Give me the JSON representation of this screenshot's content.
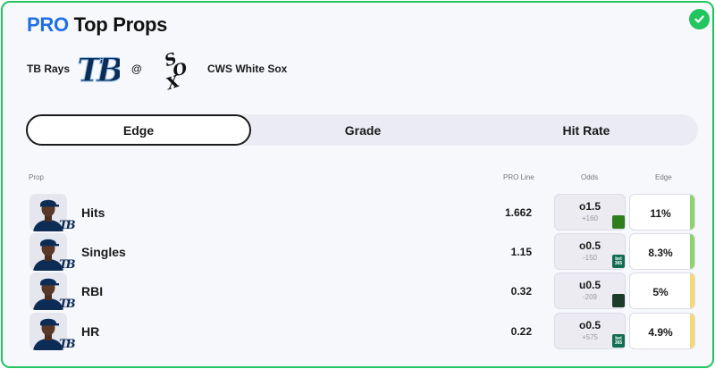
{
  "header": {
    "title_pro": "PRO",
    "title_rest": "Top Props"
  },
  "matchup": {
    "away_team": "TB Rays",
    "separator": "@",
    "home_team": "CWS White Sox",
    "away_logo_text": "TB",
    "home_logo_text": "SOX"
  },
  "tabs": [
    {
      "label": "Edge",
      "active": true
    },
    {
      "label": "Grade",
      "active": false
    },
    {
      "label": "Hit Rate",
      "active": false
    }
  ],
  "table": {
    "headers": {
      "prop": "Prop",
      "pro_line": "PRO Line",
      "odds": "Odds",
      "edge": "Edge"
    },
    "rows": [
      {
        "prop": "Hits",
        "pro_line": "1.662",
        "odds_line": "o1.5",
        "odds_price": "+160",
        "book": "draftkings-icon",
        "book_text": "",
        "book_color": "#2e7d1f",
        "edge": "11%",
        "edge_color": "#8fd16f"
      },
      {
        "prop": "Singles",
        "pro_line": "1.15",
        "odds_line": "o0.5",
        "odds_price": "-150",
        "book": "bet365-icon",
        "book_text": "bet 365",
        "book_color": "#126e51",
        "edge": "8.3%",
        "edge_color": "#8fd16f"
      },
      {
        "prop": "RBI",
        "pro_line": "0.32",
        "odds_line": "u0.5",
        "odds_price": "-209",
        "book": "fanduel-icon",
        "book_text": "",
        "book_color": "#1d3b2a",
        "edge": "5%",
        "edge_color": "#f7d774"
      },
      {
        "prop": "HR",
        "pro_line": "0.22",
        "odds_line": "o0.5",
        "odds_price": "+575",
        "book": "bet365-icon",
        "book_text": "bet 365",
        "book_color": "#126e51",
        "edge": "4.9%",
        "edge_color": "#f7d774"
      }
    ]
  },
  "colors": {
    "accent": "#1f6fe5",
    "border": "#22c55e",
    "edge_high": "#8fd16f",
    "edge_mid": "#f7d774"
  }
}
